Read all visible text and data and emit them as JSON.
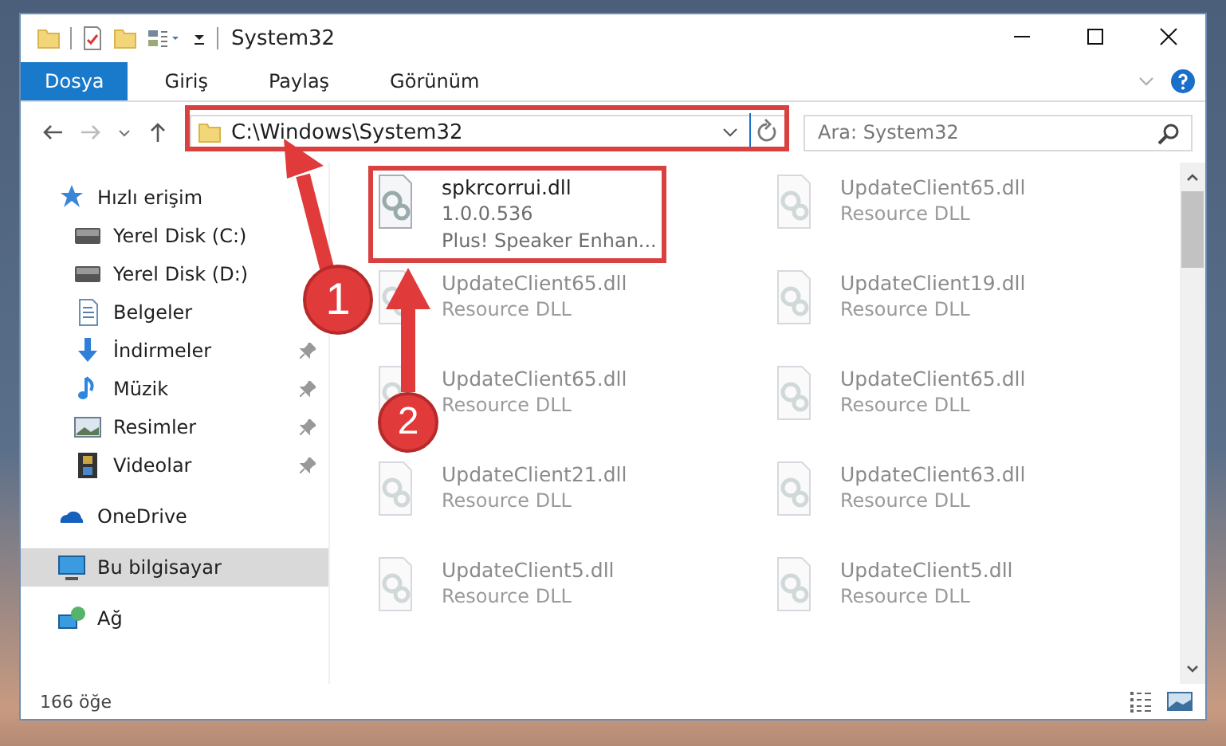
{
  "window": {
    "title": "System32"
  },
  "ribbon": {
    "tabs": [
      {
        "label": "Dosya",
        "selected": true
      },
      {
        "label": "Giriş",
        "selected": false
      },
      {
        "label": "Paylaş",
        "selected": false
      },
      {
        "label": "Görünüm",
        "selected": false
      }
    ]
  },
  "address_bar": {
    "path": "C:\\Windows\\System32"
  },
  "search": {
    "placeholder": "Ara: System32"
  },
  "sidebar": {
    "items": [
      {
        "label": "Hızlı erişim",
        "kind": "star",
        "pinned": false,
        "selected": false
      },
      {
        "label": "Yerel Disk (C:)",
        "kind": "drive",
        "pinned": false,
        "selected": false
      },
      {
        "label": "Yerel Disk (D:)",
        "kind": "drive",
        "pinned": false,
        "selected": false
      },
      {
        "label": "Belgeler",
        "kind": "document",
        "pinned": false,
        "selected": false
      },
      {
        "label": "İndirmeler",
        "kind": "download",
        "pinned": true,
        "selected": false
      },
      {
        "label": "Müzik",
        "kind": "music",
        "pinned": true,
        "selected": false
      },
      {
        "label": "Resimler",
        "kind": "image",
        "pinned": true,
        "selected": false
      },
      {
        "label": "Videolar",
        "kind": "video",
        "pinned": true,
        "selected": false
      },
      {
        "label": "OneDrive",
        "kind": "cloud",
        "pinned": false,
        "selected": false
      },
      {
        "label": "Bu bilgisayar",
        "kind": "computer",
        "pinned": false,
        "selected": true
      },
      {
        "label": "Ağ",
        "kind": "network",
        "pinned": false,
        "selected": false
      }
    ]
  },
  "files": [
    {
      "name": "spkrcorrui.dll",
      "lines": [
        "1.0.0.536",
        "Plus! Speaker Enhan..."
      ],
      "blurred": false
    },
    {
      "name": "UpdateClient65.dll",
      "lines": [
        "Resource DLL"
      ],
      "blurred": true
    },
    {
      "name": "UpdateClient65.dll",
      "lines": [
        "Resource DLL"
      ],
      "blurred": true
    },
    {
      "name": "UpdateClient19.dll",
      "lines": [
        "Resource DLL"
      ],
      "blurred": true
    },
    {
      "name": "UpdateClient65.dll",
      "lines": [
        "Resource DLL"
      ],
      "blurred": true
    },
    {
      "name": "UpdateClient65.dll",
      "lines": [
        "Resource DLL"
      ],
      "blurred": true
    },
    {
      "name": "UpdateClient21.dll",
      "lines": [
        "Resource DLL"
      ],
      "blurred": true
    },
    {
      "name": "UpdateClient63.dll",
      "lines": [
        "Resource DLL"
      ],
      "blurred": true
    },
    {
      "name": "UpdateClient5.dll",
      "lines": [
        "Resource DLL"
      ],
      "blurred": true
    },
    {
      "name": "UpdateClient5.dll",
      "lines": [
        "Resource DLL"
      ],
      "blurred": true
    }
  ],
  "status_bar": {
    "count": "166 öğe"
  },
  "annotations": [
    {
      "label": "1"
    },
    {
      "label": "2"
    }
  ]
}
